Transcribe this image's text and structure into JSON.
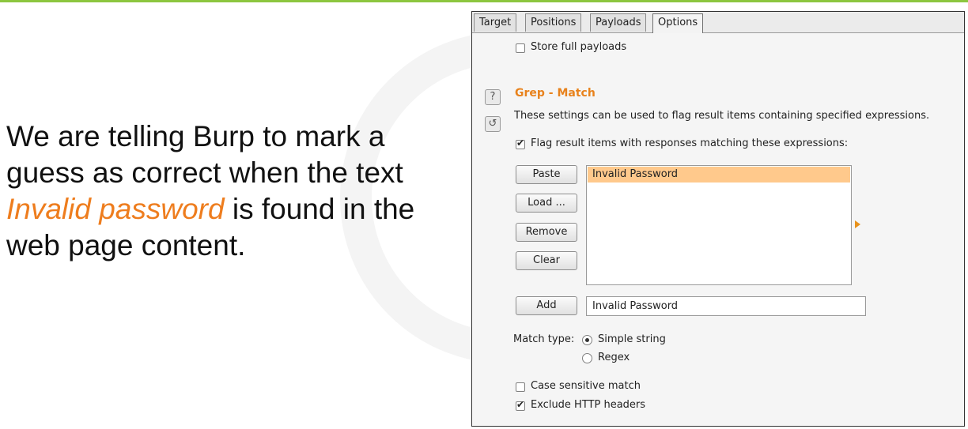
{
  "slide": {
    "text_before": "We are telling Burp to mark a guess as correct when the text ",
    "highlight": "Invalid password",
    "text_after": " is found in the web page content."
  },
  "tabs": [
    "Target",
    "Positions",
    "Payloads",
    "Options"
  ],
  "active_tab": "Options",
  "store_full_payloads": {
    "label": "Store full payloads",
    "checked": false
  },
  "grep_match": {
    "title": "Grep - Match",
    "description": "These settings can be used to flag result items containing specified expressions.",
    "flag_label": "Flag result items with responses matching these expressions:",
    "flag_checked": true,
    "buttons": {
      "paste": "Paste",
      "load": "Load ...",
      "remove": "Remove",
      "clear": "Clear",
      "add": "Add"
    },
    "items": [
      "Invalid Password"
    ],
    "input_value": "Invalid Password",
    "match_type_label": "Match type:",
    "match_options": [
      "Simple string",
      "Regex"
    ],
    "match_selected": "Simple string",
    "case_sensitive": {
      "label": "Case sensitive match",
      "checked": false
    },
    "exclude_headers": {
      "label": "Exclude HTTP headers",
      "checked": true
    }
  },
  "colors": {
    "accent": "#e8821c",
    "highlight_text": "#ee7d1e",
    "selection": "#ffc98c",
    "top_bar": "#8cc63f"
  }
}
